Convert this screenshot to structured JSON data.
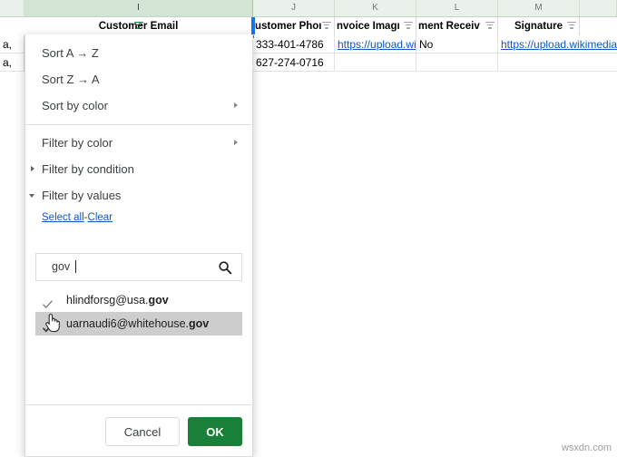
{
  "spreadsheet": {
    "column_letters": [
      "I",
      "J",
      "K",
      "L",
      "M"
    ],
    "active_column_letter": "I",
    "field_headers": [
      {
        "label": "Customer Email",
        "icon": "filter-funnel-icon",
        "active": true
      },
      {
        "label": "ustomer Phoı",
        "icon": "filter-icon",
        "active": false
      },
      {
        "label": "nvoice Imagı",
        "icon": "filter-icon",
        "active": false
      },
      {
        "label": "ment Receiv",
        "icon": "filter-icon",
        "active": false
      },
      {
        "label": "Signature",
        "icon": "filter-icon",
        "active": false
      }
    ],
    "rows": [
      {
        "partial_left": "a,",
        "phone": "333-401-4786",
        "invoice_image": "https://upload.wi",
        "payment_received": "No",
        "signature": "https://upload.wikimedia."
      },
      {
        "partial_left": "a,",
        "phone": "627-274-0716",
        "invoice_image": "",
        "payment_received": "",
        "signature": ""
      }
    ]
  },
  "filter_panel": {
    "menu_items": [
      {
        "label": "Sort A → Z",
        "name": "sort-a-z",
        "marker": "none",
        "submenu": false
      },
      {
        "label": "Sort Z → A",
        "name": "sort-z-a",
        "marker": "none",
        "submenu": false
      },
      {
        "label": "Sort by color",
        "name": "sort-by-color",
        "marker": "none",
        "submenu": true
      },
      {
        "label": "Filter by color",
        "name": "filter-by-color",
        "marker": "none",
        "submenu": true
      },
      {
        "label": "Filter by condition",
        "name": "filter-by-condition",
        "marker": "collapsed",
        "submenu": false
      },
      {
        "label": "Filter by values",
        "name": "filter-by-values",
        "marker": "expanded",
        "submenu": false
      }
    ],
    "select_all_label": "Select all",
    "separator_label": "-",
    "clear_label": "Clear",
    "search": {
      "value": "gov",
      "placeholder": "",
      "icon": "search-icon"
    },
    "values": [
      {
        "text_prefix": "hlindforsg@usa.",
        "text_bold": "gov",
        "checked": true,
        "hovered": false
      },
      {
        "text_prefix": "uarnaudi6@whitehouse.",
        "text_bold": "gov",
        "checked": true,
        "hovered": true
      }
    ],
    "buttons": {
      "cancel": "Cancel",
      "ok": "OK"
    }
  },
  "watermark": "wsxdn.com",
  "colors": {
    "accent_green": "#188038",
    "link_blue": "#1155cc",
    "selection_blue": "#1a73e8",
    "header_green": "#e8f0e9",
    "hover_grey": "#cdcdcd"
  }
}
